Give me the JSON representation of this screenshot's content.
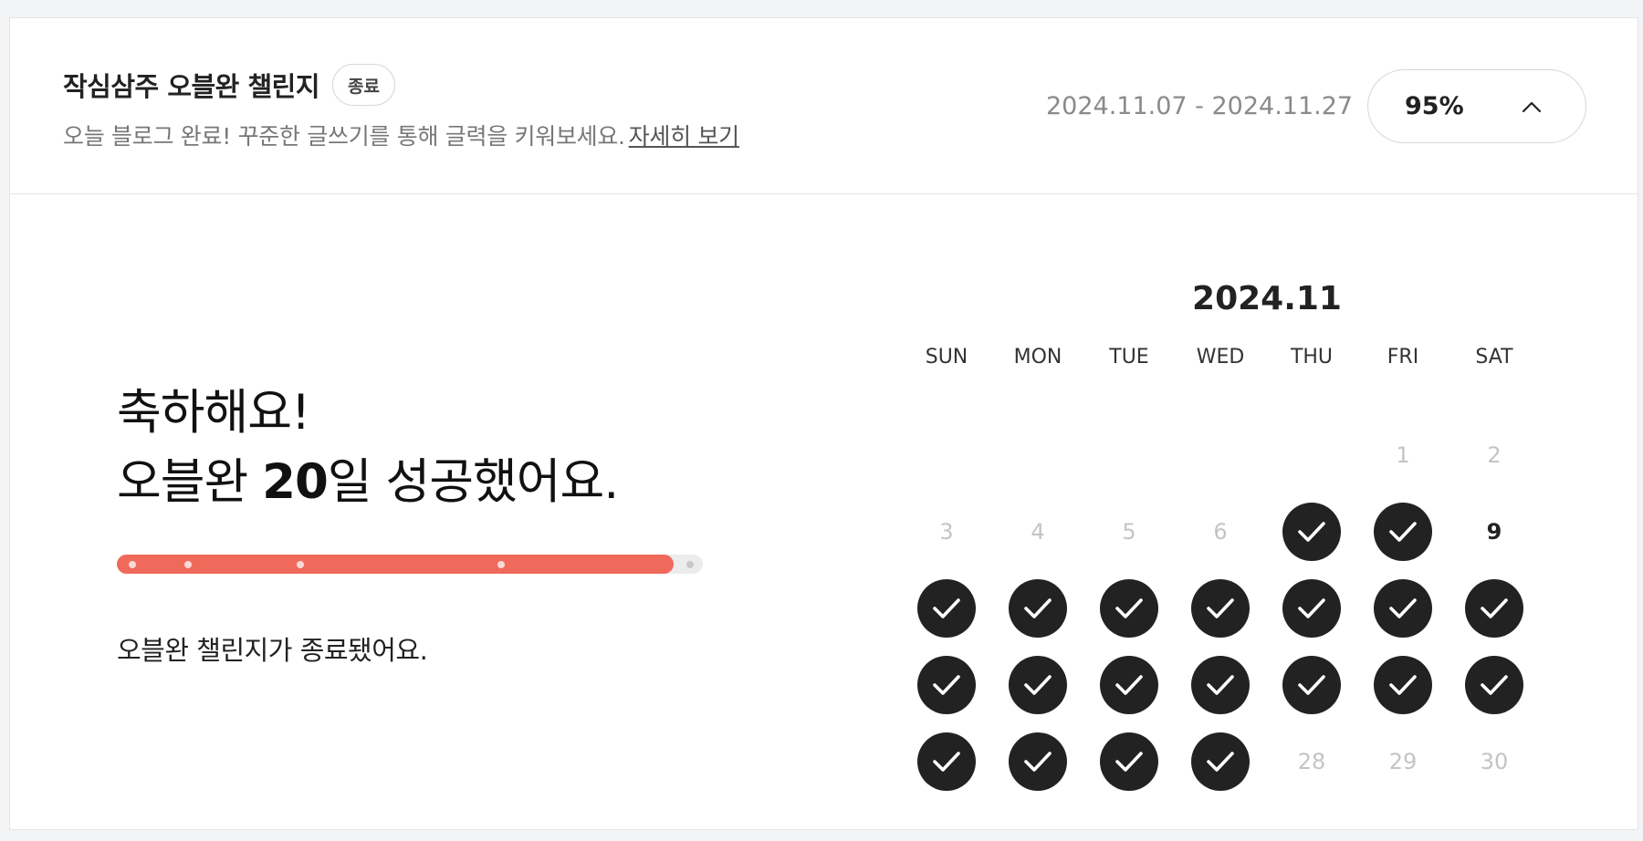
{
  "challenge": {
    "title": "작심삼주 오블완 챌린지",
    "badge": "종료",
    "description": "오늘 블로그 완료! 꾸준한 글쓰기를 통해 글력을 키워보세요.",
    "detail_link": "자세히 보기",
    "period": "2024.11.07 - 2024.11.27",
    "progress_label": "95%",
    "progress_fraction": 0.95
  },
  "result": {
    "line1": "축하해요!",
    "line2_prefix": "오블완 ",
    "success_days": "20",
    "line2_suffix": "일 성공했어요.",
    "ended_message": "오블완 챌린지가 종료됐어요."
  },
  "calendar": {
    "month_label": "2024.11",
    "weekdays": [
      "SUN",
      "MON",
      "TUE",
      "WED",
      "THU",
      "FRI",
      "SAT"
    ],
    "first_weekday_index": 5,
    "days_in_month": 30,
    "today": 9,
    "checked_days": [
      7,
      8,
      10,
      11,
      12,
      13,
      14,
      15,
      16,
      17,
      18,
      19,
      20,
      21,
      22,
      23,
      24,
      25,
      26,
      27
    ]
  },
  "icons": {
    "toggle": "chevron-up-icon",
    "check": "check-icon"
  },
  "colors": {
    "progress_fill": "#ef6a5b",
    "check_bg": "#222222"
  }
}
